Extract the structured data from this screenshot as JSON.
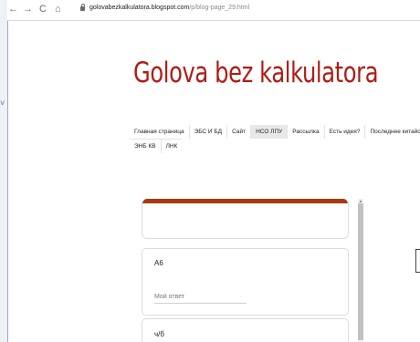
{
  "browser": {
    "back_icon": "←",
    "forward_icon": "→",
    "reload_icon": "C",
    "home_icon": "⌂",
    "url_host": "golovabezkalkulatora.blogspot.com",
    "url_path": "/p/blog-page_29.html"
  },
  "gutter_mark": "˅",
  "blog": {
    "title": "Golova bez kalkulatora"
  },
  "nav": {
    "row1": [
      "Главная страница",
      "ЭБС И БД",
      "Сайт",
      "НСО ЛПУ",
      "Рассылка",
      "Есть идея?",
      "Последнее китайское"
    ],
    "row2": [
      "ЭНБ КВ",
      "ЛНК"
    ],
    "active": "НСО ЛПУ"
  },
  "form": {
    "questions": [
      {
        "title": "А6",
        "placeholder": "Мой ответ"
      },
      {
        "title": "ч/б"
      }
    ]
  },
  "colors": {
    "title_red": "#b01c15",
    "form_accent": "#a8380f"
  }
}
